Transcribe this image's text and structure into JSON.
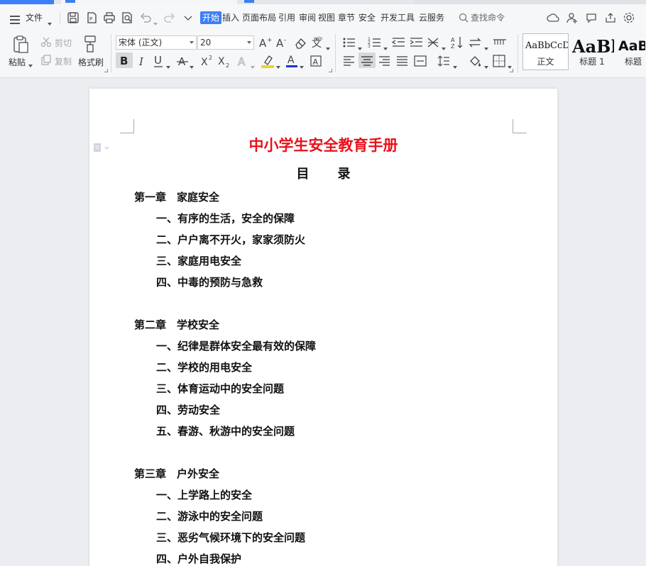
{
  "menu": {
    "file_label": "文件",
    "tabs": [
      {
        "label": "开始",
        "active": true
      },
      {
        "label": "插入"
      },
      {
        "label": "页面布局"
      },
      {
        "label": "引用"
      },
      {
        "label": "审阅"
      },
      {
        "label": "视图"
      },
      {
        "label": "章节"
      },
      {
        "label": "安全"
      },
      {
        "label": "开发工具"
      },
      {
        "label": "云服务"
      }
    ],
    "search_placeholder": "查找命令"
  },
  "ribbon": {
    "paste_label": "粘贴",
    "cut_label": "剪切",
    "copy_label": "复制",
    "format_painter_label": "格式刷",
    "font_name": "宋体 (正文)",
    "font_size": "20",
    "styles": [
      {
        "sample": "AaBbCcDd",
        "name": "正文"
      },
      {
        "sample": "AaBl",
        "name": "标题 1"
      },
      {
        "sample": "AaB",
        "name": "标题"
      }
    ]
  },
  "colors": {
    "accent": "#3d7ff6",
    "title_red": "#e8101a",
    "highlight_yellow": "#f5d31b",
    "font_color_red": "#e8101a"
  },
  "document": {
    "title": "中小学生安全教育手册",
    "subtitle": "目录",
    "toc": [
      {
        "text": "第一章　家庭安全",
        "level": 1
      },
      {
        "text": "一、有序的生活，安全的保障",
        "level": 2
      },
      {
        "text": "二、户户离不开火，家家须防火",
        "level": 2
      },
      {
        "text": "三、家庭用电安全",
        "level": 2
      },
      {
        "text": "四、中毒的预防与急救",
        "level": 2
      },
      {
        "text": "第二章　学校安全",
        "level": 1
      },
      {
        "text": "一、纪律是群体安全最有效的保障",
        "level": 2
      },
      {
        "text": "二、学校的用电安全",
        "level": 2
      },
      {
        "text": "三、体育运动中的安全问题",
        "level": 2
      },
      {
        "text": "四、劳动安全",
        "level": 2
      },
      {
        "text": "五、春游、秋游中的安全问题",
        "level": 2
      },
      {
        "text": "第三章　户外安全",
        "level": 1
      },
      {
        "text": "一、上学路上的安全",
        "level": 2
      },
      {
        "text": "二、游泳中的安全问题",
        "level": 2
      },
      {
        "text": "三、恶劣气候环境下的安全问题",
        "level": 2
      },
      {
        "text": "四、户外自我保护",
        "level": 2
      }
    ]
  }
}
